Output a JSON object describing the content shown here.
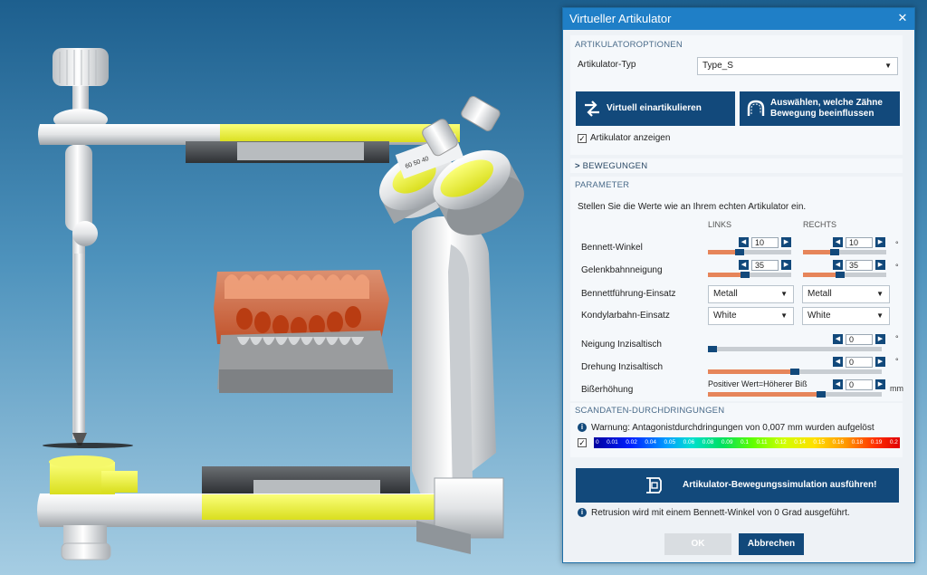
{
  "dialog": {
    "title": "Virtueller Artikulator",
    "close_glyph": "✕"
  },
  "articulator_options": {
    "header": "ARTIKULATOROPTIONEN",
    "type_label": "Artikulator-Typ",
    "type_value": "Type_S",
    "btn_virtual": "Virtuell einartikulieren",
    "btn_select_line1": "Auswählen, welche Zähne",
    "btn_select_line2": "Bewegung beeinflussen",
    "show_label": "Artikulator anzeigen",
    "show_checked": true
  },
  "movements": {
    "header": "BEWEGUNGEN",
    "expanded": false
  },
  "parameters": {
    "header": "PARAMETER",
    "intro": "Stellen Sie die Werte wie an Ihrem echten Artikulator ein.",
    "col_left": "LINKS",
    "col_right": "RECHTS",
    "bennett_label": "Bennett-Winkel",
    "bennett_left": "10",
    "bennett_right": "10",
    "bennett_fraction": 0.38,
    "gelenk_label": "Gelenkbahnneigung",
    "gelenk_left": "35",
    "gelenk_right": "35",
    "gelenk_fraction": 0.45,
    "bennettfuehrung_label": "Bennettführung-Einsatz",
    "bennettfuehrung_left": "Metall",
    "bennettfuehrung_right": "Metall",
    "kondylar_label": "Kondylarbahn-Einsatz",
    "kondylar_left": "White",
    "kondylar_right": "White",
    "neigung_label": "Neigung Inzisaltisch",
    "neigung_value": "0",
    "neigung_fraction": 0.0,
    "drehung_label": "Drehung Inzisaltisch",
    "drehung_value": "0",
    "drehung_fraction": 0.5,
    "biss_label": "Bißerhöhung",
    "biss_hint": "Positiver Wert=Höherer Biß",
    "biss_value": "0",
    "biss_fraction": 0.65,
    "unit_degree": "°",
    "unit_mm": "mm"
  },
  "scan": {
    "header": "SCANDATEN-DURCHDRINGUNGEN",
    "warning": "Warnung: Antagonistdurchdringungen von 0,007 mm wurden aufgelöst",
    "scale_checked": true,
    "scale_ticks": [
      "0",
      "0.01",
      "0.02",
      "0.04",
      "0.05",
      "0.06",
      "0.08",
      "0.09",
      "0.1",
      "0.11",
      "0.12",
      "0.14",
      "0.15",
      "0.16",
      "0.18",
      "0.19",
      "0.2"
    ]
  },
  "simulation": {
    "run_label": "Artikulator-Bewegungssimulation ausführen!",
    "info": "Retrusion wird mit einem Bennett-Winkel von 0 Grad ausgeführt."
  },
  "footer": {
    "ok": "OK",
    "cancel": "Abbrechen"
  },
  "viewport_labels": {
    "scale_marks": "60 50 40"
  }
}
